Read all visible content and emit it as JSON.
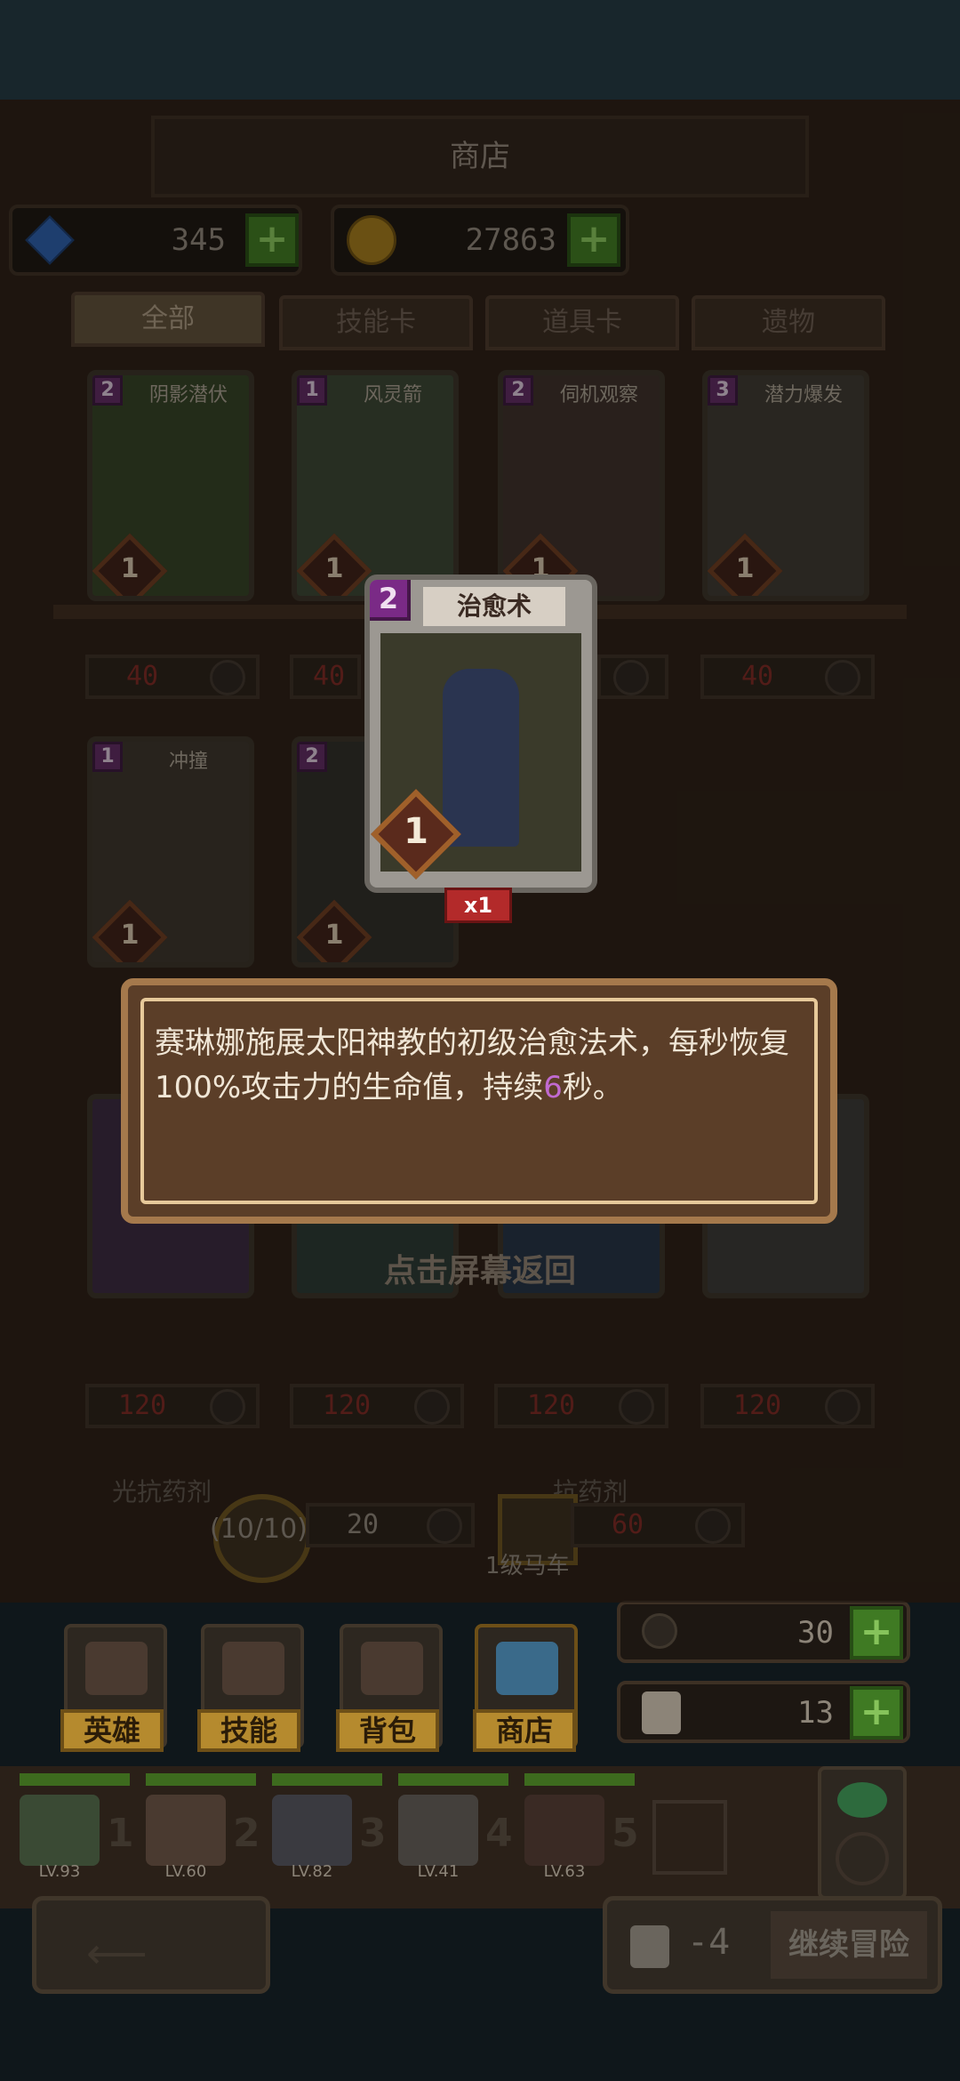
{
  "header": {
    "title": "商店"
  },
  "resources": {
    "gems": "345",
    "gold": "27863"
  },
  "tabs": [
    {
      "label": "全部",
      "active": true
    },
    {
      "label": "技能卡",
      "active": false
    },
    {
      "label": "道具卡",
      "active": false
    },
    {
      "label": "遗物",
      "active": false
    }
  ],
  "cards_row1": [
    {
      "name": "阴影潜伏",
      "cost": "2",
      "level": "1",
      "price": "40"
    },
    {
      "name": "风灵箭",
      "cost": "1",
      "level": "1",
      "price": "40"
    },
    {
      "name": "伺机观察",
      "cost": "2",
      "level": "1",
      "price": "40"
    },
    {
      "name": "潜力爆发",
      "cost": "3",
      "level": "1",
      "price": "40"
    }
  ],
  "cards_row2": [
    {
      "name": "冲撞",
      "cost": "1",
      "level": "1"
    },
    {
      "name": "",
      "cost": "2",
      "level": "1"
    }
  ],
  "row3_prices": [
    "120",
    "120",
    "120",
    "120"
  ],
  "items": {
    "item1_name": "光抗药剂",
    "item1_stock": "(10/10)",
    "item1_price": "20",
    "item2_name": "抗药剂",
    "item2_price": "60",
    "wagon_label": "1级马车"
  },
  "popup": {
    "card_name": "治愈术",
    "cost": "2",
    "level": "1",
    "count": "x1",
    "desc_part1": "赛琳娜施展太阳神教的初级治愈法术，每秒恢复100%攻击力的生命值，持续",
    "desc_highlight": "6",
    "desc_part2": "秒。",
    "hint": "点击屏幕返回"
  },
  "side_counters": {
    "sword_count": "30",
    "bag_count": "13"
  },
  "menu": [
    {
      "label": "英雄"
    },
    {
      "label": "技能"
    },
    {
      "label": "背包"
    },
    {
      "label": "商店"
    }
  ],
  "party": [
    {
      "slot": "1",
      "level": "LV.93"
    },
    {
      "slot": "2",
      "level": "LV.60"
    },
    {
      "slot": "3",
      "level": "LV.82"
    },
    {
      "slot": "4",
      "level": "LV.41"
    },
    {
      "slot": "5",
      "level": "LV.63"
    }
  ],
  "footer": {
    "cost": "-4",
    "continue_label": "继续冒险"
  },
  "colors": {
    "accent_gold": "#b58a2e",
    "plus_green": "#3f7a23",
    "highlight_purple": "#c06ad0",
    "price_red": "#7b2a24"
  }
}
